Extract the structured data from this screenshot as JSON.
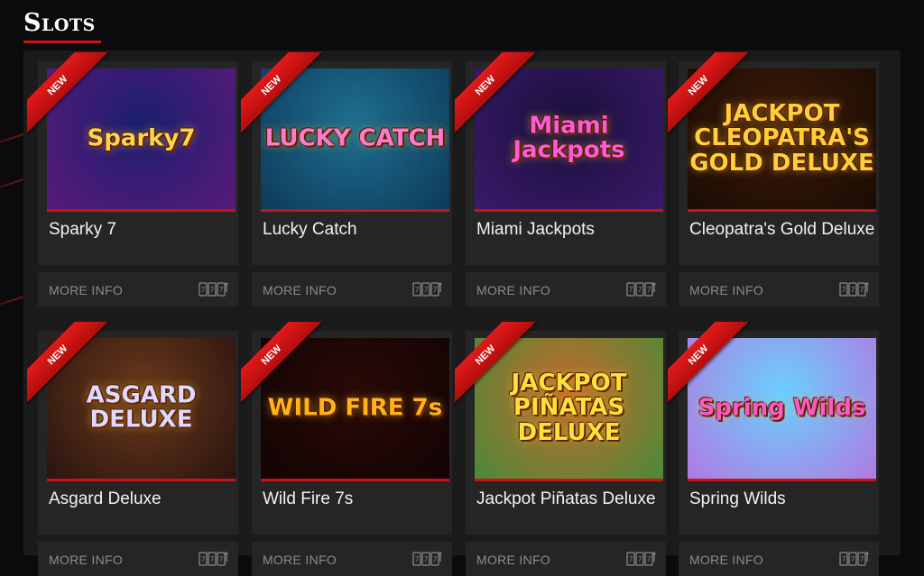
{
  "page": {
    "title": "Slots"
  },
  "ribbon_text": "NEW",
  "more_info_label": "MORE INFO",
  "games": [
    {
      "name": "Sparky 7",
      "art": "Sparky7",
      "bg": [
        "#1a1f6e",
        "#5a1a7a"
      ],
      "art_color": "#ffd34a"
    },
    {
      "name": "Lucky Catch",
      "art": "LUCKY CATCH",
      "bg": [
        "#1f6f8f",
        "#0d3a5a"
      ],
      "art_color": "#ff7ac8"
    },
    {
      "name": "Miami Jackpots",
      "art": "Miami Jackpots",
      "bg": [
        "#1a0f3a",
        "#3a1a6a"
      ],
      "art_color": "#ff5ad8"
    },
    {
      "name": "Cleopatra's Gold Deluxe",
      "art": "JACKPOT CLEOPATRA'S GOLD DELUXE",
      "bg": [
        "#3a1a08",
        "#1a0c04"
      ],
      "art_color": "#ffcf3a"
    },
    {
      "name": "Asgard Deluxe",
      "art": "ASGARD DELUXE",
      "bg": [
        "#6a3a1a",
        "#2a1410"
      ],
      "art_color": "#e0d8ff"
    },
    {
      "name": "Wild Fire 7s",
      "art": "WILD FIRE 7s",
      "bg": [
        "#2a0a06",
        "#120405"
      ],
      "art_color": "#ffb21a"
    },
    {
      "name": "Jackpot Piñatas Deluxe",
      "art": "JACKPOT PIÑATAS DELUXE",
      "bg": [
        "#c46a2a",
        "#4a8a3a"
      ],
      "art_color": "#ffe03a"
    },
    {
      "name": "Spring Wilds",
      "art": "Spring Wilds",
      "bg": [
        "#6ad0ff",
        "#b07ae0"
      ],
      "art_color": "#ff5ac0"
    }
  ],
  "colors": {
    "accent": "#d01313",
    "panel": "#1b1b1c",
    "card": "#252526",
    "muted_text": "#8b8b8b"
  }
}
